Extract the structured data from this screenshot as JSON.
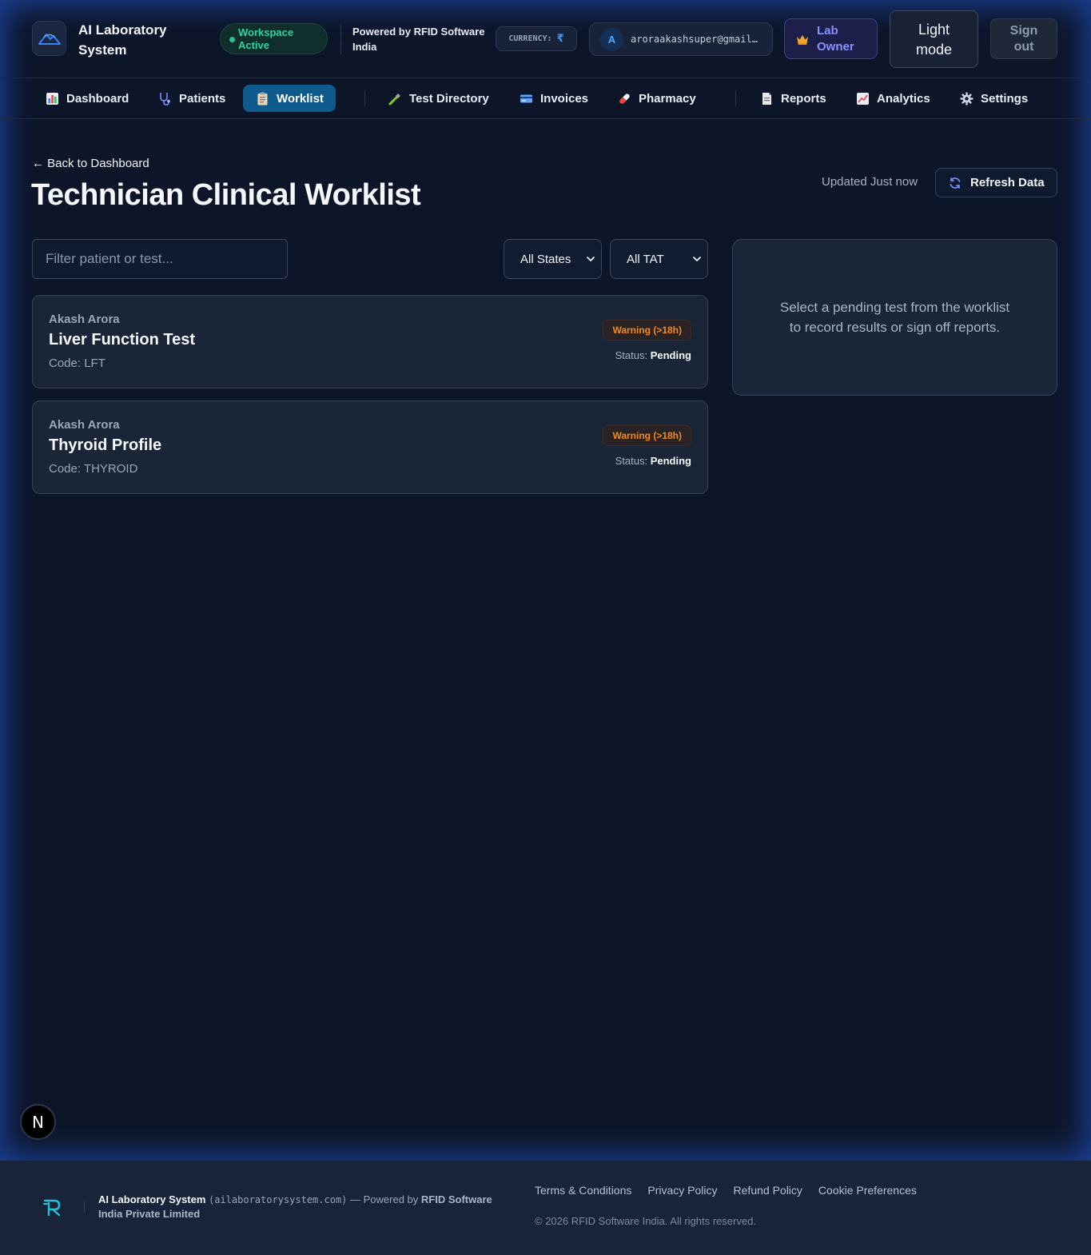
{
  "header": {
    "app_title": "AI Laboratory System",
    "workspace_status": "Workspace Active",
    "powered_by": "Powered by RFID Software India",
    "currency_label": "CURRENCY:",
    "currency_symbol": "₹",
    "user_initial": "A",
    "user_email": "aroraakashsuper@gmail.com",
    "role_label": "Lab Owner",
    "theme_toggle_label": "Light mode",
    "signout_label": "Sign out"
  },
  "nav": {
    "items": [
      {
        "label": "Dashboard",
        "icon": "bar-chart-icon",
        "active": false
      },
      {
        "label": "Patients",
        "icon": "stethoscope-icon",
        "active": false
      },
      {
        "label": "Worklist",
        "icon": "clipboard-icon",
        "active": true
      },
      {
        "label": "Test Directory",
        "icon": "pipette-icon",
        "active": false
      },
      {
        "label": "Invoices",
        "icon": "credit-card-icon",
        "active": false
      },
      {
        "label": "Pharmacy",
        "icon": "pill-icon",
        "active": false
      },
      {
        "label": "Reports",
        "icon": "document-icon",
        "active": false
      },
      {
        "label": "Analytics",
        "icon": "line-chart-icon",
        "active": false
      },
      {
        "label": "Settings",
        "icon": "gear-icon",
        "active": false
      }
    ]
  },
  "page": {
    "back_link": "← Back to Dashboard",
    "title": "Technician Clinical Worklist",
    "updated_text": "Updated Just now",
    "refresh_label": "Refresh Data"
  },
  "filters": {
    "search_placeholder": "Filter patient or test...",
    "search_value": "",
    "state_selected": "All States",
    "tat_selected": "All TAT"
  },
  "worklist": [
    {
      "patient": "Akash Arora",
      "test": "Liver Function Test",
      "code": "Code: LFT",
      "tat_badge": "Warning (>18h)",
      "status_label": "Status:",
      "status": "Pending"
    },
    {
      "patient": "Akash Arora",
      "test": "Thyroid Profile",
      "code": "Code: THYROID",
      "tat_badge": "Warning (>18h)",
      "status_label": "Status:",
      "status": "Pending"
    }
  ],
  "side_panel": {
    "message": "Select a pending test from the worklist to record results or sign off reports."
  },
  "dev_badge": {
    "letter": "N"
  },
  "footer": {
    "brand": "AI Laboratory System",
    "domain": "(ailaboratorysystem.com)",
    "powered_prefix": "— Powered by",
    "company": "RFID Software India Private Limited",
    "links": [
      "Terms & Conditions",
      "Privacy Policy",
      "Refund Policy",
      "Cookie Preferences"
    ],
    "copyright": "© 2026 RFID Software India. All rights reserved."
  },
  "colors": {
    "background": "#0d1528",
    "accent_active_tab": "#0f5a8c",
    "workspace_green": "#2dd4a0",
    "warning_orange": "#f38a1c",
    "role_purple": "#8b90ff",
    "glow_blue": "#2563eb"
  }
}
